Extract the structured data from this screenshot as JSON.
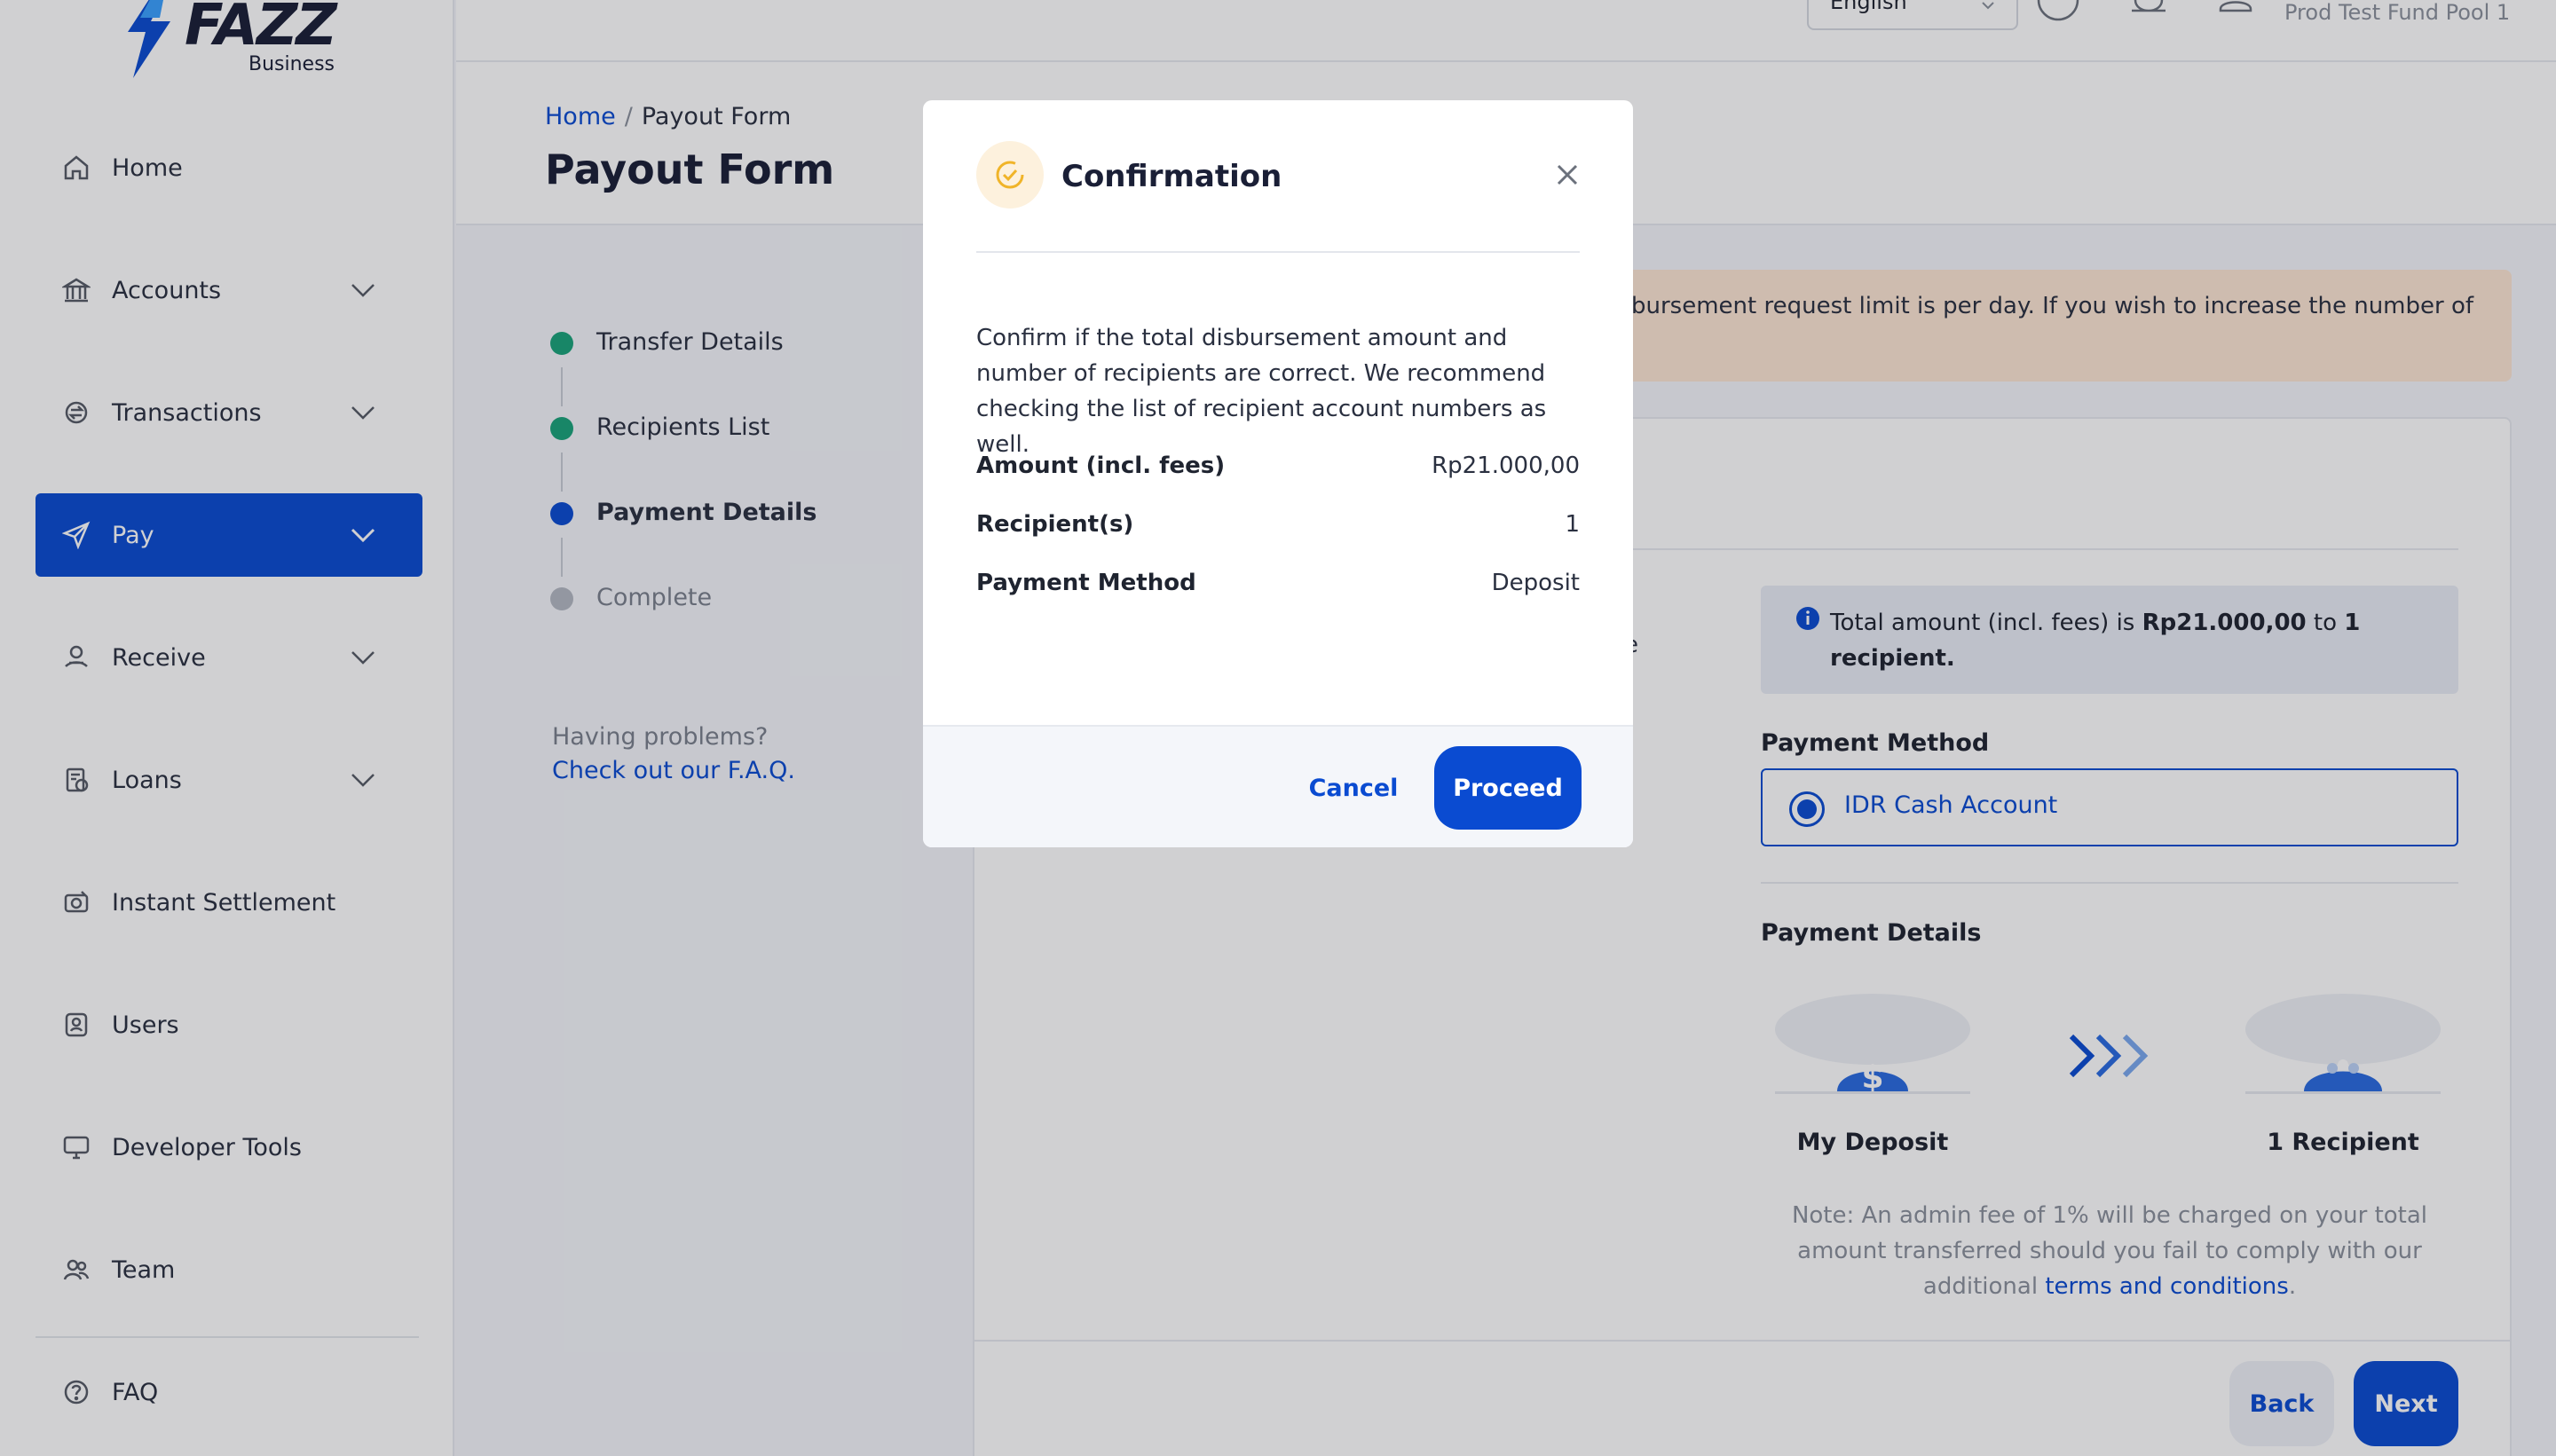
{
  "brand": {
    "name": "FAZZ",
    "sub": "Business"
  },
  "topbar": {
    "language": "English",
    "account": "Prod Test Fund Pool 1"
  },
  "sidebar": {
    "items": [
      {
        "label": "Home",
        "icon": "home-icon",
        "has_chevron": false
      },
      {
        "label": "Accounts",
        "icon": "bank-icon",
        "has_chevron": true
      },
      {
        "label": "Transactions",
        "icon": "transactions-icon",
        "has_chevron": true
      },
      {
        "label": "Pay",
        "icon": "send-icon",
        "has_chevron": true,
        "active": true
      },
      {
        "label": "Receive",
        "icon": "receive-icon",
        "has_chevron": true
      },
      {
        "label": "Loans",
        "icon": "loans-icon",
        "has_chevron": true
      },
      {
        "label": "Instant Settlement",
        "icon": "settlement-icon",
        "has_chevron": false
      },
      {
        "label": "Users",
        "icon": "users-icon",
        "has_chevron": false
      },
      {
        "label": "Developer Tools",
        "icon": "monitor-icon",
        "has_chevron": false
      },
      {
        "label": "Team",
        "icon": "team-icon",
        "has_chevron": false
      }
    ],
    "faq": {
      "label": "FAQ",
      "icon": "question-icon"
    }
  },
  "page": {
    "breadcrumb_home": "Home",
    "breadcrumb_sep": "/",
    "breadcrumb_current": "Payout Form",
    "title": "Payout Form"
  },
  "stepper": [
    {
      "label": "Transfer Details",
      "state": "done"
    },
    {
      "label": "Recipients List",
      "state": "done"
    },
    {
      "label": "Payment Details",
      "state": "current"
    },
    {
      "label": "Complete",
      "state": "todo"
    }
  ],
  "help": {
    "question": "Having problems?",
    "link": "Check out our F.A.Q."
  },
  "banner": {
    "text": "bursement request limit is per day. If you wish to increase the number of"
  },
  "card": {
    "stub": "e",
    "info_prefix": "Total amount (incl. fees) is ",
    "info_amount": "Rp21.000,00",
    "info_mid": " to ",
    "info_recipient": "1 recipient.",
    "payment_method_label": "Payment Method",
    "payment_method_option": "IDR Cash Account",
    "payment_details_label": "Payment Details",
    "from_label": "My Deposit",
    "to_label": "1 Recipient",
    "note_text": "Note: An admin fee of 1% will be charged on your total amount transferred should you fail to comply with our additional ",
    "note_link": "terms and conditions",
    "note_end": ".",
    "back_label": "Back",
    "next_label": "Next"
  },
  "modal": {
    "title": "Confirmation",
    "description": "Confirm if the total disbursement amount and number of recipients are correct. We recommend checking the list of recipient account numbers as well.",
    "rows": [
      {
        "key": "Amount (incl. fees)",
        "value": "Rp21.000,00"
      },
      {
        "key": "Recipient(s)",
        "value": "1"
      },
      {
        "key": "Payment Method",
        "value": "Deposit"
      }
    ],
    "cancel_label": "Cancel",
    "proceed_label": "Proceed"
  },
  "colors": {
    "primary": "#0a4bd1",
    "success": "#1aa37a",
    "warning_bg": "#fde7d4",
    "confirm_icon": "#f0b429"
  }
}
